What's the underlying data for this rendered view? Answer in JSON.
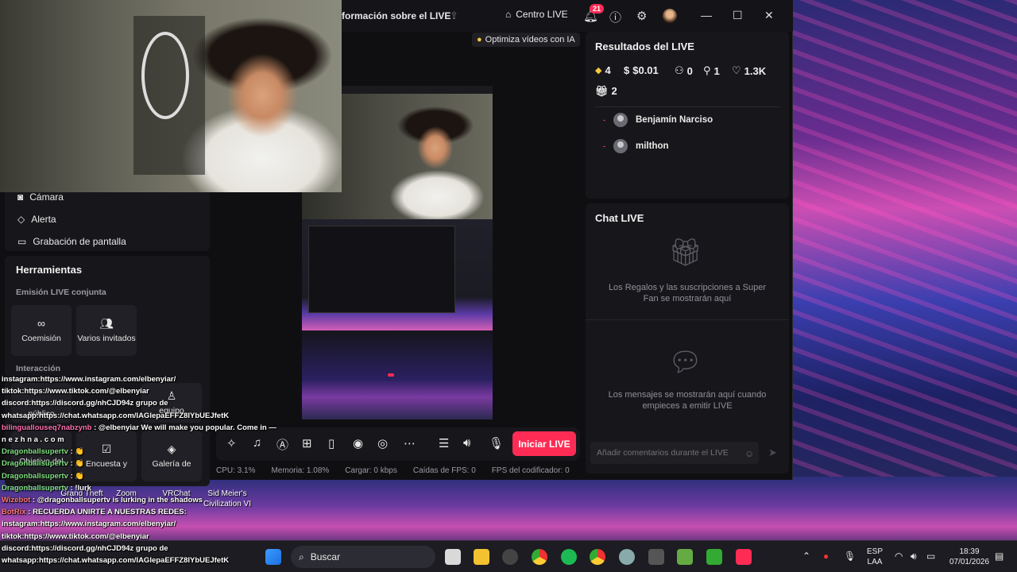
{
  "titlebar": {
    "title": "formación sobre el LIVE",
    "centro_label": "Centro LIVE",
    "notif_count": "21"
  },
  "ai_chip": "Optimiza vídeos con IA",
  "sources": {
    "items": [
      {
        "label": "Cámara"
      },
      {
        "label": "Alerta"
      },
      {
        "label": "Grabación de pantalla"
      }
    ]
  },
  "tools": {
    "title": "Herramientas",
    "joint_section": "Emisión LIVE conjunta",
    "coemision": "Coemisión",
    "varios": "Varios invitados",
    "interaccion_section": "Interacción",
    "row2": [
      "público",
      "equipo"
    ],
    "row3": [
      "Objetivo del",
      "Encuesta y",
      "Galería de"
    ]
  },
  "controls": {
    "start_label": "Iniciar LIVE"
  },
  "stats": {
    "cpu": "CPU:  3.1%",
    "mem": "Memoria:  1.08%",
    "load": "Cargar:  0 kbps",
    "fps_drop": "Caídas de FPS:  0",
    "fps_enc": "FPS del codificador:  0"
  },
  "results": {
    "title": "Resultados del LIVE",
    "diamonds": "4",
    "money": "$0.01",
    "viewers": "0",
    "new_followers": "1",
    "likes": "1.3K",
    "gifts": "2",
    "users": [
      {
        "name": "Benjamín Narciso"
      },
      {
        "name": "milthon"
      }
    ]
  },
  "chat": {
    "title": "Chat LIVE",
    "gifts_msg": "Los Regalos y las suscripciones a Super Fan se mostrarán aquí",
    "messages_msg": "Los mensajes se mostrarán aquí cuando empieces a emitir LIVE",
    "input_placeholder": "Añadir comentarios durante el LIVE"
  },
  "overlay_chat": [
    {
      "user": "",
      "text": "instagram:https://www.instagram.com/elbenyiar/"
    },
    {
      "user": "",
      "text": "tiktok:https://www.tiktok.com/@elbenyiar"
    },
    {
      "user": "",
      "text": "discord:https://discord.gg/nhCJD94z grupo de"
    },
    {
      "user": "",
      "text": "whatsapp:https://chat.whatsapp.com/IAGlepaEFFZ8IYbUEJfetK"
    },
    {
      "user": "bilinguallouseq7nabzynb",
      "text": " : @elbenyiar We will make you popular. Come in —"
    },
    {
      "user": "",
      "text": "n e z h n a . c o m"
    },
    {
      "user": "Dragonballsupertv",
      "text": " : 👏"
    },
    {
      "user": "Dragonballsupertv",
      "text": " : 👏"
    },
    {
      "user": "Dragonballsupertv",
      "text": " : 👏"
    },
    {
      "user": "Dragonballsupertv",
      "text": " : !lurk"
    },
    {
      "user": "Wizebot",
      "text": " : @dragonballsupertv is lurking in the shadows"
    },
    {
      "user": "BotRix",
      "text": " : RECUERDA UNIRTE A NUESTRAS REDES:"
    },
    {
      "user": "",
      "text": "instagram:https://www.instagram.com/elbenyiar/"
    },
    {
      "user": "",
      "text": "tiktok:https://www.tiktok.com/@elbenyiar"
    },
    {
      "user": "",
      "text": "discord:https://discord.gg/nhCJD94z grupo de"
    },
    {
      "user": "",
      "text": "whatsapp:https://chat.whatsapp.com/IAGlepaEFFZ8IYbUEJfetK"
    }
  ],
  "desktop_icons": [
    "Grand Theft",
    "Zoom",
    "VRChat",
    "Sid Meier's",
    "Civilization VI"
  ],
  "taskbar": {
    "search_placeholder": "Buscar",
    "lang_top": "ESP",
    "lang_bottom": "LAA",
    "time": "18:39",
    "date": "07/01/2026"
  },
  "colors": {
    "accent": "#fe2c55",
    "panel": "#17171b",
    "window_bg": "#0f0f12"
  }
}
